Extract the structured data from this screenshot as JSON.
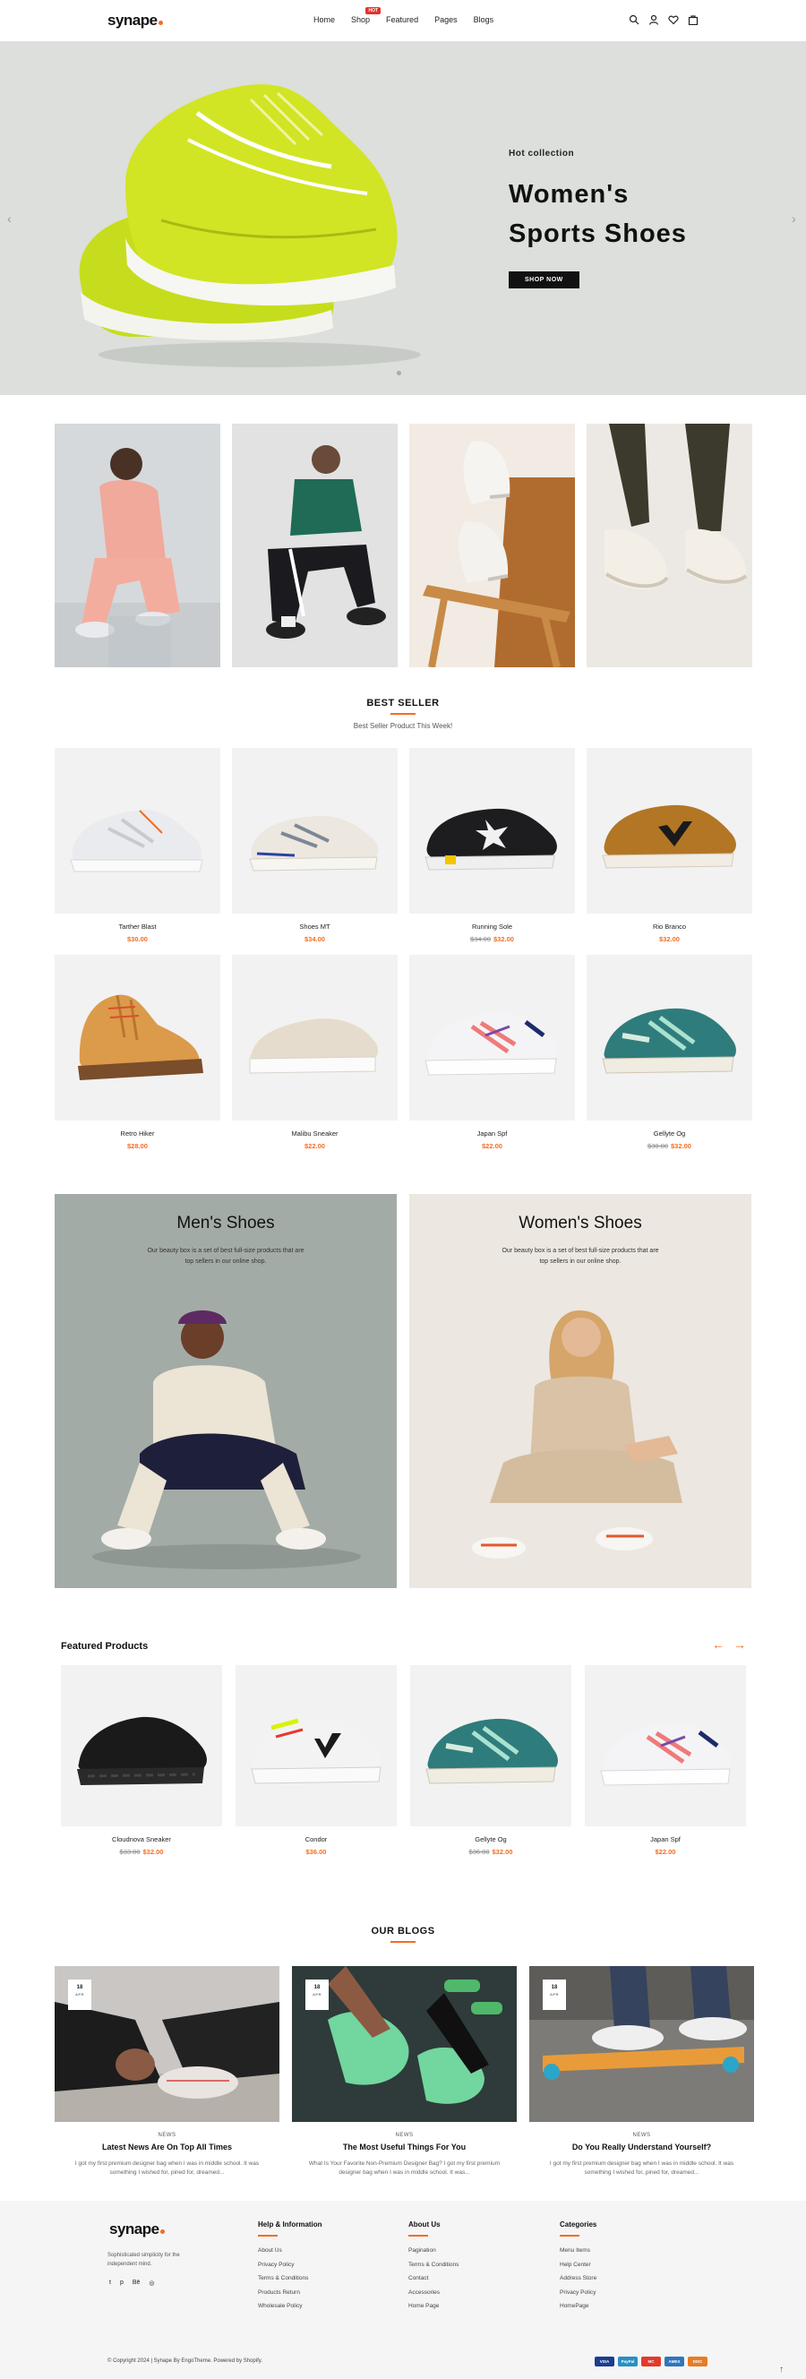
{
  "header": {
    "logo": "synape",
    "nav": [
      {
        "label": "Home"
      },
      {
        "label": "Shop",
        "badge": "HOT"
      },
      {
        "label": "Featured"
      },
      {
        "label": "Pages"
      },
      {
        "label": "Blogs"
      }
    ],
    "icons": [
      "search-icon",
      "user-icon",
      "heart-icon",
      "bag-icon"
    ]
  },
  "hero": {
    "kicker": "Hot collection",
    "title_line1": "Women's",
    "title_line2": "Sports Shoes",
    "button": "SHOP NOW",
    "accent": "#f36d21"
  },
  "best_seller": {
    "title": "BEST SELLER",
    "subtitle": "Best Seller Product This Week!",
    "products": [
      {
        "name": "Tarther Blast",
        "price": "$30.00",
        "old_price": ""
      },
      {
        "name": "Shoes MT",
        "price": "$34.00",
        "old_price": ""
      },
      {
        "name": "Running Sole",
        "price": "$32.00",
        "old_price": "$34.00"
      },
      {
        "name": "Rio Branco",
        "price": "$32.00",
        "old_price": ""
      },
      {
        "name": "Retro Hiker",
        "price": "$28.00",
        "old_price": ""
      },
      {
        "name": "Malibu Sneaker",
        "price": "$22.00",
        "old_price": ""
      },
      {
        "name": "Japan Spf",
        "price": "$22.00",
        "old_price": ""
      },
      {
        "name": "Gellyte Og",
        "price": "$32.00",
        "old_price": "$30.00"
      }
    ]
  },
  "categories": {
    "men": {
      "title": "Men's Shoes",
      "desc": "Our beauty box is a set of best full-size products that are top sellers in our online shop."
    },
    "women": {
      "title": "Women's Shoes",
      "desc": "Our beauty box is a set of best full-size products that are top sellers in our online shop."
    }
  },
  "featured": {
    "title": "Featured Products",
    "arrow_prev": "←",
    "arrow_next": "→",
    "products": [
      {
        "name": "Cloudnova Sneaker",
        "price": "$32.00",
        "old_price": "$33.00"
      },
      {
        "name": "Condor",
        "price": "$36.00",
        "old_price": ""
      },
      {
        "name": "Gellyte Og",
        "price": "$32.00",
        "old_price": "$36.00"
      },
      {
        "name": "Japan Spf",
        "price": "$22.00",
        "old_price": ""
      }
    ]
  },
  "blogs": {
    "title": "OUR BLOGS",
    "posts": [
      {
        "day": "18",
        "month": "APR",
        "category": "NEWS",
        "title": "Latest News Are On Top All Times",
        "excerpt": "I got my first premium designer bag when I was in middle school. It was something I wished for, pined for, dreamed..."
      },
      {
        "day": "18",
        "month": "APR",
        "category": "NEWS",
        "title": "The Most Useful Things For You",
        "excerpt": "What Is Your Favorite Non-Premium Designer Bag? I got my first premium designer bag when I was in middle school. It was..."
      },
      {
        "day": "18",
        "month": "APR",
        "category": "NEWS",
        "title": "Do You Really Understand Yourself?",
        "excerpt": "I got my first premium designer bag when I was in middle school. It was something I wished for, pined for, dreamed..."
      }
    ]
  },
  "footer": {
    "logo": "synape",
    "tagline": "Sophisticated simplicity for the independent mind.",
    "social": [
      "twitter-icon",
      "pinterest-icon",
      "behance-icon",
      "instagram-icon"
    ],
    "social_glyphs": [
      "t",
      "p",
      "Bē",
      "◎"
    ],
    "columns": [
      {
        "title": "Help & Information",
        "items": [
          "About Us",
          "Privacy Policy",
          "Terms & Conditions",
          "Products Return",
          "Wholesale Policy"
        ]
      },
      {
        "title": "About Us",
        "items": [
          "Pagination",
          "Terms & Conditions",
          "Contact",
          "Accessories",
          "Home Page"
        ]
      },
      {
        "title": "Categories",
        "items": [
          "Menu Items",
          "Help Center",
          "Address Store",
          "Privacy Policy",
          "HomePage"
        ]
      }
    ],
    "copyright": "© Copyright 2024 | Synape By EngoTheme. Powered by Shopify.",
    "payments": [
      {
        "label": "VISA",
        "color": "#1a3d8f"
      },
      {
        "label": "PayPal",
        "color": "#2790c3"
      },
      {
        "label": "MC",
        "color": "#e23a2c"
      },
      {
        "label": "AMEX",
        "color": "#2e77bb"
      },
      {
        "label": "DISC",
        "color": "#e57d26"
      }
    ],
    "to_top": "↑"
  }
}
